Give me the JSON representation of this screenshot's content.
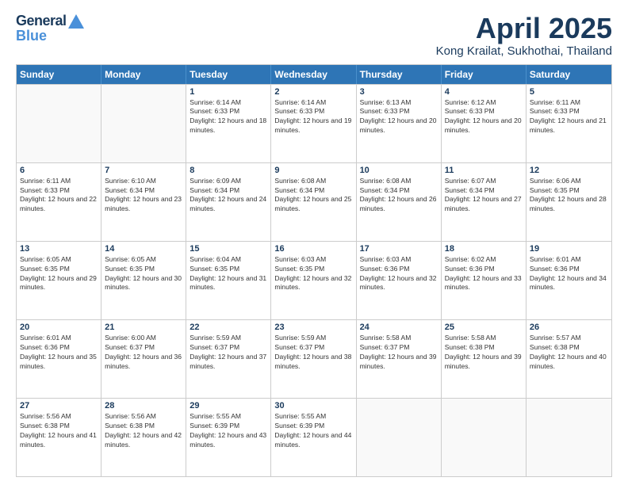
{
  "logo": {
    "general": "General",
    "blue": "Blue"
  },
  "title": "April 2025",
  "location": "Kong Krailat, Sukhothai, Thailand",
  "header_days": [
    "Sunday",
    "Monday",
    "Tuesday",
    "Wednesday",
    "Thursday",
    "Friday",
    "Saturday"
  ],
  "weeks": [
    [
      {
        "day": "",
        "sunrise": "",
        "sunset": "",
        "daylight": ""
      },
      {
        "day": "",
        "sunrise": "",
        "sunset": "",
        "daylight": ""
      },
      {
        "day": "1",
        "sunrise": "Sunrise: 6:14 AM",
        "sunset": "Sunset: 6:33 PM",
        "daylight": "Daylight: 12 hours and 18 minutes."
      },
      {
        "day": "2",
        "sunrise": "Sunrise: 6:14 AM",
        "sunset": "Sunset: 6:33 PM",
        "daylight": "Daylight: 12 hours and 19 minutes."
      },
      {
        "day": "3",
        "sunrise": "Sunrise: 6:13 AM",
        "sunset": "Sunset: 6:33 PM",
        "daylight": "Daylight: 12 hours and 20 minutes."
      },
      {
        "day": "4",
        "sunrise": "Sunrise: 6:12 AM",
        "sunset": "Sunset: 6:33 PM",
        "daylight": "Daylight: 12 hours and 20 minutes."
      },
      {
        "day": "5",
        "sunrise": "Sunrise: 6:11 AM",
        "sunset": "Sunset: 6:33 PM",
        "daylight": "Daylight: 12 hours and 21 minutes."
      }
    ],
    [
      {
        "day": "6",
        "sunrise": "Sunrise: 6:11 AM",
        "sunset": "Sunset: 6:33 PM",
        "daylight": "Daylight: 12 hours and 22 minutes."
      },
      {
        "day": "7",
        "sunrise": "Sunrise: 6:10 AM",
        "sunset": "Sunset: 6:34 PM",
        "daylight": "Daylight: 12 hours and 23 minutes."
      },
      {
        "day": "8",
        "sunrise": "Sunrise: 6:09 AM",
        "sunset": "Sunset: 6:34 PM",
        "daylight": "Daylight: 12 hours and 24 minutes."
      },
      {
        "day": "9",
        "sunrise": "Sunrise: 6:08 AM",
        "sunset": "Sunset: 6:34 PM",
        "daylight": "Daylight: 12 hours and 25 minutes."
      },
      {
        "day": "10",
        "sunrise": "Sunrise: 6:08 AM",
        "sunset": "Sunset: 6:34 PM",
        "daylight": "Daylight: 12 hours and 26 minutes."
      },
      {
        "day": "11",
        "sunrise": "Sunrise: 6:07 AM",
        "sunset": "Sunset: 6:34 PM",
        "daylight": "Daylight: 12 hours and 27 minutes."
      },
      {
        "day": "12",
        "sunrise": "Sunrise: 6:06 AM",
        "sunset": "Sunset: 6:35 PM",
        "daylight": "Daylight: 12 hours and 28 minutes."
      }
    ],
    [
      {
        "day": "13",
        "sunrise": "Sunrise: 6:05 AM",
        "sunset": "Sunset: 6:35 PM",
        "daylight": "Daylight: 12 hours and 29 minutes."
      },
      {
        "day": "14",
        "sunrise": "Sunrise: 6:05 AM",
        "sunset": "Sunset: 6:35 PM",
        "daylight": "Daylight: 12 hours and 30 minutes."
      },
      {
        "day": "15",
        "sunrise": "Sunrise: 6:04 AM",
        "sunset": "Sunset: 6:35 PM",
        "daylight": "Daylight: 12 hours and 31 minutes."
      },
      {
        "day": "16",
        "sunrise": "Sunrise: 6:03 AM",
        "sunset": "Sunset: 6:35 PM",
        "daylight": "Daylight: 12 hours and 32 minutes."
      },
      {
        "day": "17",
        "sunrise": "Sunrise: 6:03 AM",
        "sunset": "Sunset: 6:36 PM",
        "daylight": "Daylight: 12 hours and 32 minutes."
      },
      {
        "day": "18",
        "sunrise": "Sunrise: 6:02 AM",
        "sunset": "Sunset: 6:36 PM",
        "daylight": "Daylight: 12 hours and 33 minutes."
      },
      {
        "day": "19",
        "sunrise": "Sunrise: 6:01 AM",
        "sunset": "Sunset: 6:36 PM",
        "daylight": "Daylight: 12 hours and 34 minutes."
      }
    ],
    [
      {
        "day": "20",
        "sunrise": "Sunrise: 6:01 AM",
        "sunset": "Sunset: 6:36 PM",
        "daylight": "Daylight: 12 hours and 35 minutes."
      },
      {
        "day": "21",
        "sunrise": "Sunrise: 6:00 AM",
        "sunset": "Sunset: 6:37 PM",
        "daylight": "Daylight: 12 hours and 36 minutes."
      },
      {
        "day": "22",
        "sunrise": "Sunrise: 5:59 AM",
        "sunset": "Sunset: 6:37 PM",
        "daylight": "Daylight: 12 hours and 37 minutes."
      },
      {
        "day": "23",
        "sunrise": "Sunrise: 5:59 AM",
        "sunset": "Sunset: 6:37 PM",
        "daylight": "Daylight: 12 hours and 38 minutes."
      },
      {
        "day": "24",
        "sunrise": "Sunrise: 5:58 AM",
        "sunset": "Sunset: 6:37 PM",
        "daylight": "Daylight: 12 hours and 39 minutes."
      },
      {
        "day": "25",
        "sunrise": "Sunrise: 5:58 AM",
        "sunset": "Sunset: 6:38 PM",
        "daylight": "Daylight: 12 hours and 39 minutes."
      },
      {
        "day": "26",
        "sunrise": "Sunrise: 5:57 AM",
        "sunset": "Sunset: 6:38 PM",
        "daylight": "Daylight: 12 hours and 40 minutes."
      }
    ],
    [
      {
        "day": "27",
        "sunrise": "Sunrise: 5:56 AM",
        "sunset": "Sunset: 6:38 PM",
        "daylight": "Daylight: 12 hours and 41 minutes."
      },
      {
        "day": "28",
        "sunrise": "Sunrise: 5:56 AM",
        "sunset": "Sunset: 6:38 PM",
        "daylight": "Daylight: 12 hours and 42 minutes."
      },
      {
        "day": "29",
        "sunrise": "Sunrise: 5:55 AM",
        "sunset": "Sunset: 6:39 PM",
        "daylight": "Daylight: 12 hours and 43 minutes."
      },
      {
        "day": "30",
        "sunrise": "Sunrise: 5:55 AM",
        "sunset": "Sunset: 6:39 PM",
        "daylight": "Daylight: 12 hours and 44 minutes."
      },
      {
        "day": "",
        "sunrise": "",
        "sunset": "",
        "daylight": ""
      },
      {
        "day": "",
        "sunrise": "",
        "sunset": "",
        "daylight": ""
      },
      {
        "day": "",
        "sunrise": "",
        "sunset": "",
        "daylight": ""
      }
    ]
  ]
}
